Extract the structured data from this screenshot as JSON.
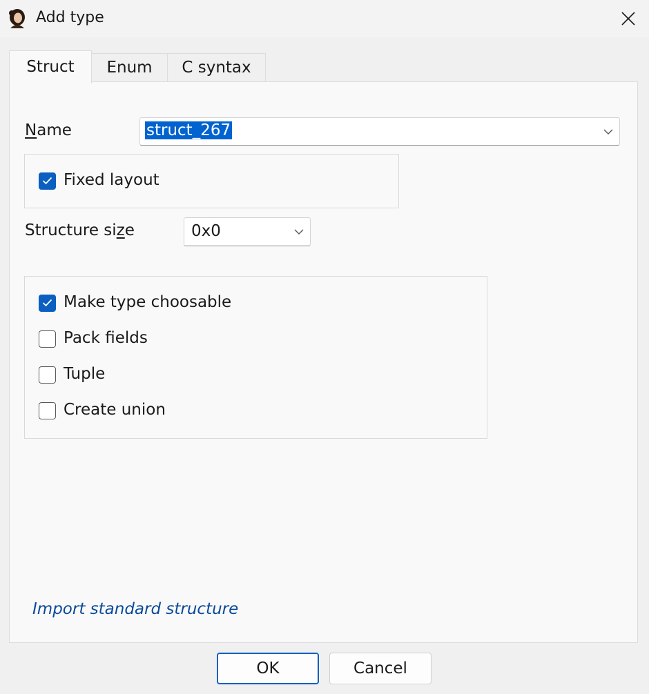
{
  "window": {
    "title": "Add type",
    "app_icon": "portrait-icon",
    "close_icon": "close-icon"
  },
  "tabs": [
    {
      "label": "Struct",
      "active": true
    },
    {
      "label": "Enum",
      "active": false
    },
    {
      "label": "C syntax",
      "active": false
    }
  ],
  "form": {
    "name_label": "Name",
    "name_value": "struct_267",
    "fixed_layout": {
      "label": "Fixed layout",
      "checked": true
    },
    "size_label": "Structure size",
    "size_value": "0x0"
  },
  "options": [
    {
      "label": "Make type choosable",
      "checked": true
    },
    {
      "label": "Pack fields",
      "checked": false
    },
    {
      "label": "Tuple",
      "checked": false
    },
    {
      "label": "Create union",
      "checked": false
    }
  ],
  "import_link": "Import standard structure",
  "buttons": {
    "ok": "OK",
    "cancel": "Cancel"
  },
  "colors": {
    "accent": "#0a5fc0",
    "selection": "#0063cf",
    "link": "#0a4a9a"
  }
}
